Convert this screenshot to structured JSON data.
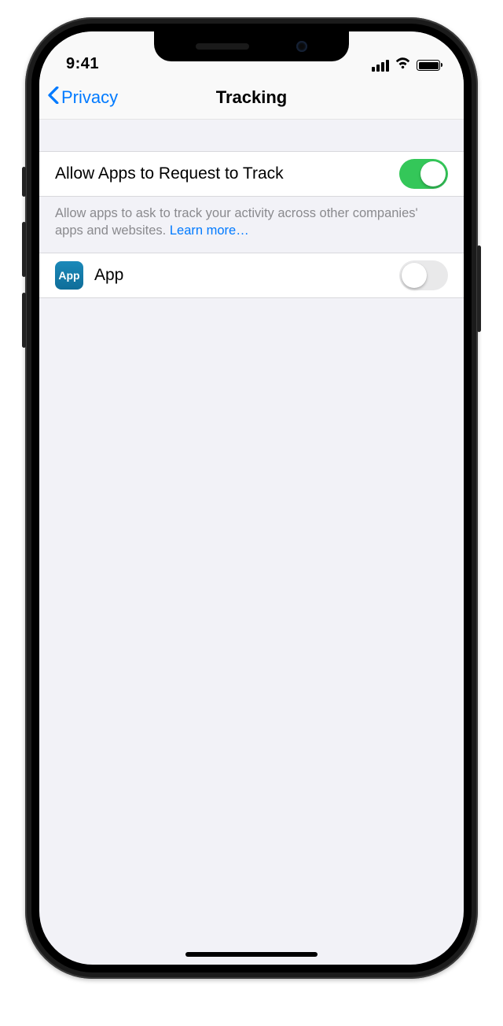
{
  "status": {
    "time": "9:41"
  },
  "nav": {
    "back_label": "Privacy",
    "title": "Tracking"
  },
  "tracking": {
    "row_label": "Allow Apps to Request to Track",
    "toggle_on": true,
    "footer": "Allow apps to ask to track your activity across other companies' apps and websites. ",
    "learn_more": "Learn more…"
  },
  "apps": [
    {
      "icon_text": "App",
      "name": "App",
      "toggle_on": false
    }
  ]
}
